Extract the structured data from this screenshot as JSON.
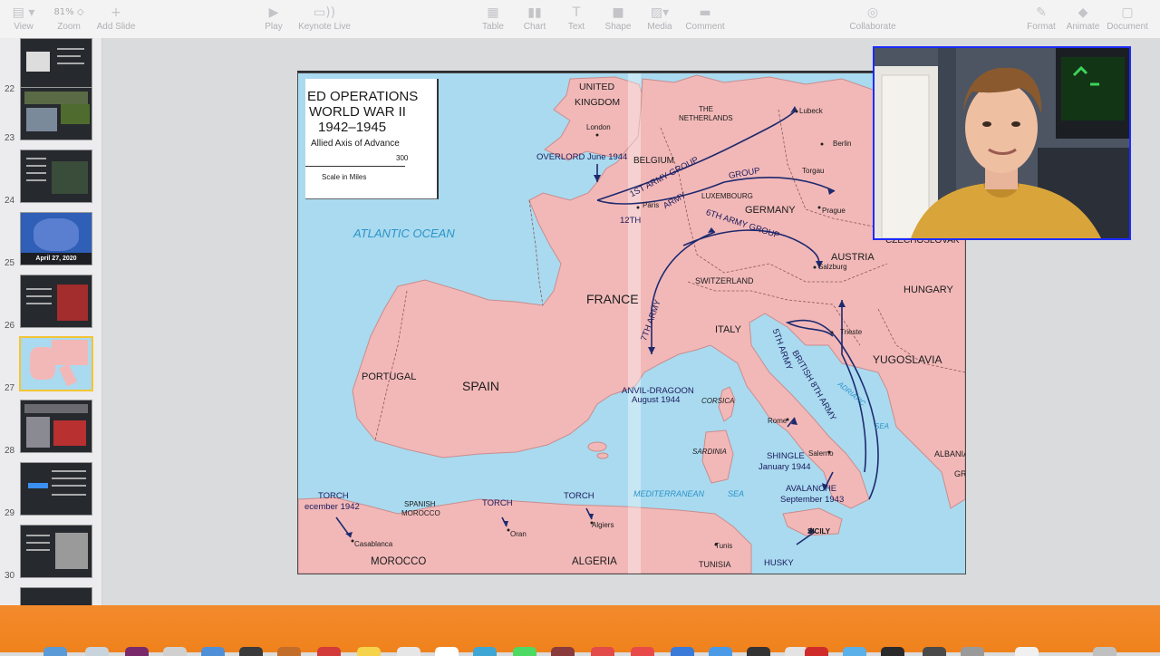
{
  "toolbar": {
    "view": "View",
    "zoom_value": "81%",
    "zoom": "Zoom",
    "add_slide": "Add Slide",
    "play": "Play",
    "keynote_live": "Keynote Live",
    "table": "Table",
    "chart": "Chart",
    "text": "Text",
    "shape": "Shape",
    "media": "Media",
    "comment": "Comment",
    "collaborate": "Collaborate",
    "format": "Format",
    "animate": "Animate",
    "document": "Document"
  },
  "navigator": {
    "slides": [
      {
        "num": "22"
      },
      {
        "num": "23"
      },
      {
        "num": "24"
      },
      {
        "num": "25",
        "caption": "April 27, 2020"
      },
      {
        "num": "26"
      },
      {
        "num": "27",
        "selected": true
      },
      {
        "num": "28"
      },
      {
        "num": "29"
      },
      {
        "num": "30"
      }
    ]
  },
  "slide": {
    "legend": {
      "line1": "ED OPERATIONS",
      "line2": "WORLD WAR II",
      "line3": "1942–1945",
      "line4": "Allied Axis of Advance",
      "scale_value": "300",
      "scale_label": "Scale in Miles"
    },
    "labels": {
      "atlantic": "ATLANTIC OCEAN",
      "united": "UNITED",
      "kingdom": "KINGDOM",
      "london": "London",
      "overlord": "OVERLORD June 1944",
      "belgium": "BELGIUM",
      "the": "THE",
      "netherlands": "NETHERLANDS",
      "lubeck": "Lubeck",
      "berlin": "Berlin",
      "torgau": "Torgau",
      "prague": "Prague",
      "luxembourg": "LUXEMBOURG",
      "paris": "Paris",
      "germany": "GERMANY",
      "first_army_group": "1ST ARMY GROUP",
      "group": "GROUP",
      "army": "ARMY",
      "twelfth": "12TH",
      "sixth_army_group": "6TH ARMY GROUP",
      "czechoslovakia": "CZECHOSLOVAK",
      "austria": "AUSTRIA",
      "salzburg": "Salzburg",
      "switzerland": "SWITZERLAND",
      "france": "FRANCE",
      "hungary": "HUNGARY",
      "seventh_army": "7TH ARMY",
      "italy": "ITALY",
      "trieste": "Trieste",
      "fifth_army": "5TH ARMY",
      "british_8th": "BRITISH 8TH ARMY",
      "yugoslavia": "YUGOSLAVIA",
      "portugal": "PORTUGAL",
      "spain": "SPAIN",
      "anvil_dragoon": "ANVIL-DRAGOON",
      "august_1944": "August 1944",
      "corsica": "CORSICA",
      "adriatic": "ADRIATIC",
      "sea": "SEA",
      "rome": "Rome",
      "shingle": "SHINGLE",
      "january_1944": "January 1944",
      "salerno": "Salerno",
      "sardinia": "SARDINIA",
      "albania": "ALBANIA",
      "gr": "GR",
      "avalanche": "AVALANCHE",
      "september_1943": "September 1943",
      "mediterranean": "MEDITERRANEAN",
      "med_sea": "SEA",
      "torch_1": "TORCH",
      "torch_1_date": "ecember 1942",
      "casablanca": "Casablanca",
      "spanish": "SPANISH",
      "morocco_sp": "MOROCCO",
      "torch_2": "TORCH",
      "oran": "Oran",
      "torch_3": "TORCH",
      "algiers": "Algiers",
      "sicily": "SICILY",
      "tunis": "Tunis",
      "morocco": "MOROCCO",
      "algeria": "ALGERIA",
      "tunisia": "TUNISIA",
      "husky": "HUSKY"
    }
  },
  "colors": {
    "land": "#f2b8b8",
    "sea": "#a9daf0",
    "arrow": "#1e2a6e",
    "webcam_border": "#1c2cff",
    "dock": "#f0821c",
    "selected_slide": "#f3c533"
  },
  "icons": {
    "view": "sidebar-icon",
    "add_slide": "plus-icon",
    "play": "play-icon",
    "keynote_live": "broadcast-icon",
    "table": "table-icon",
    "chart": "chart-icon",
    "text": "text-icon",
    "shape": "shape-icon",
    "media": "media-icon",
    "comment": "comment-icon",
    "collaborate": "collaborate-icon",
    "format": "paintbrush-icon",
    "animate": "diamond-icon",
    "document": "document-icon"
  }
}
